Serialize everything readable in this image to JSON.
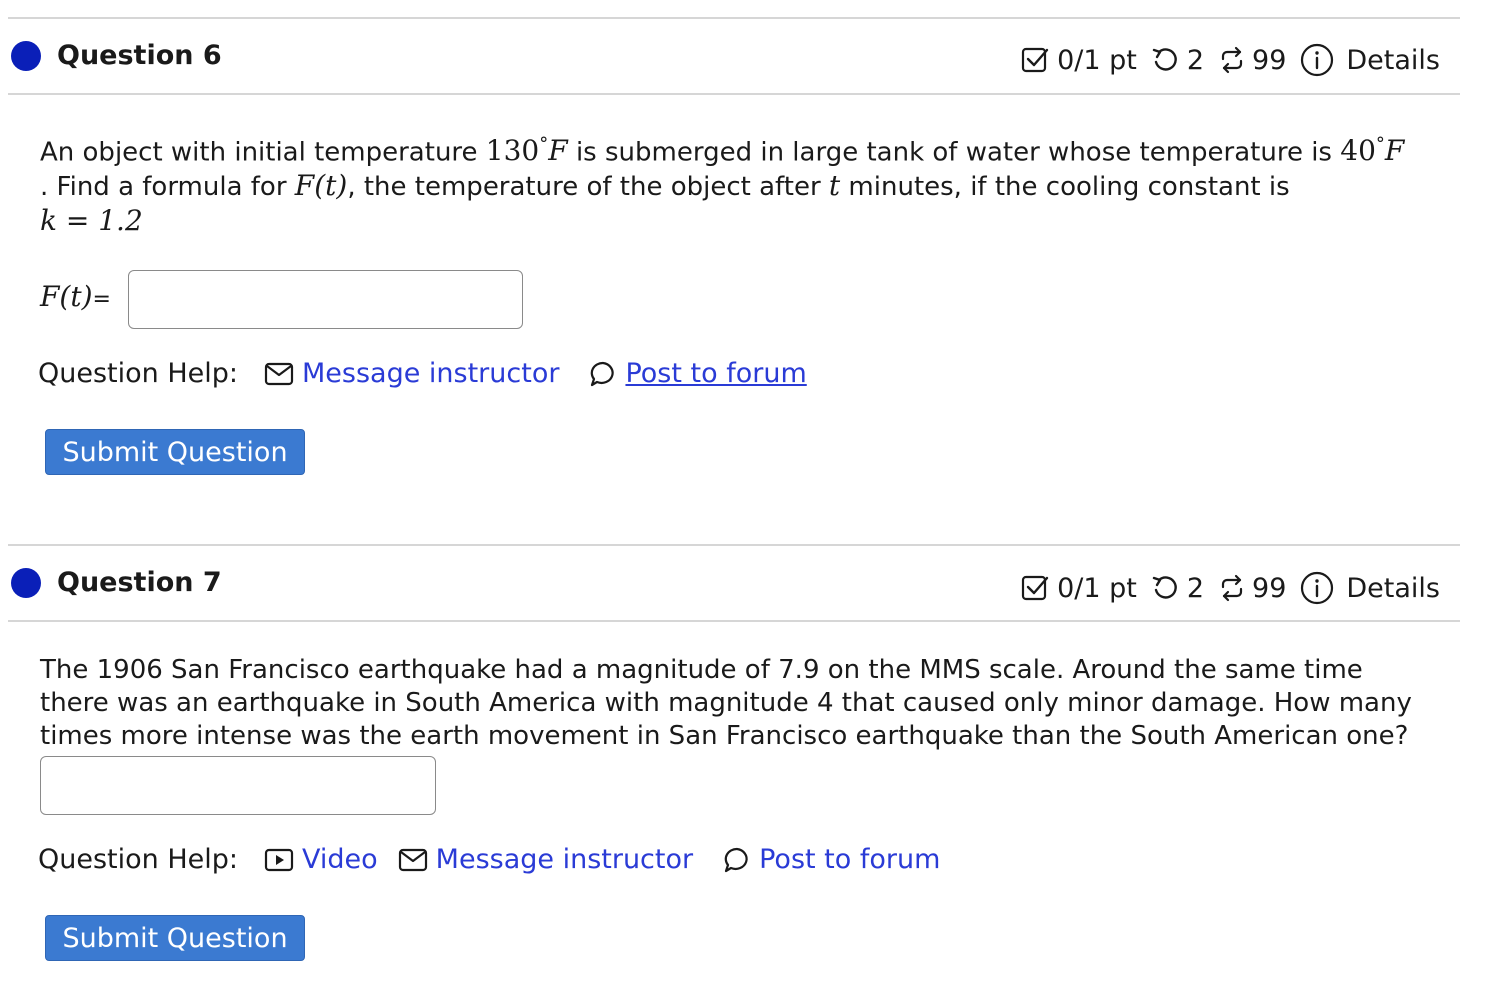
{
  "questions": [
    {
      "title": "Question 6",
      "score": "0/1 pt",
      "retries": "2",
      "attempts": "99",
      "details_label": "Details",
      "text_part1": "An object with initial temperature ",
      "temp_initial": "130",
      "text_part2": " is submerged in large tank of water whose temperature is ",
      "temp_water": "40",
      "degree_symbol": "°",
      "unit": "F",
      "text_part3": ". Find a formula for ",
      "func": "F(t)",
      "text_part4": ", the temperature of the object after ",
      "var_t": "t",
      "text_part5": " minutes, if the cooling constant is",
      "constant_expr": "k = 1.2",
      "input_label": "F(t)",
      "input_label_eq": "=",
      "input_value": "",
      "help_label": "Question Help:",
      "help_links": [
        "Message instructor",
        " Post to forum"
      ],
      "submit_label": "Submit Question"
    },
    {
      "title": "Question 7",
      "score": "0/1 pt",
      "retries": "2",
      "attempts": "99",
      "details_label": "Details",
      "text": "The 1906 San Francisco earthquake had a magnitude of 7.9 on the MMS scale. Around the same time there was an earthquake in South America with magnitude 4 that caused only minor damage. How many times more intense was the earth movement in San Francisco earthquake than the South American one?",
      "input_value": "",
      "help_label": "Question Help:",
      "help_links": [
        "Video",
        "Message instructor",
        "Post to forum"
      ],
      "submit_label": "Submit Question"
    }
  ],
  "colors": {
    "dot": "#0a1fb8",
    "link": "#2a3bd6",
    "button": "#3b7ad1"
  },
  "icons": [
    "check-square-icon",
    "retry-icon",
    "repeat-icon",
    "info-icon",
    "mail-icon",
    "chat-bubble-icon",
    "video-icon"
  ]
}
